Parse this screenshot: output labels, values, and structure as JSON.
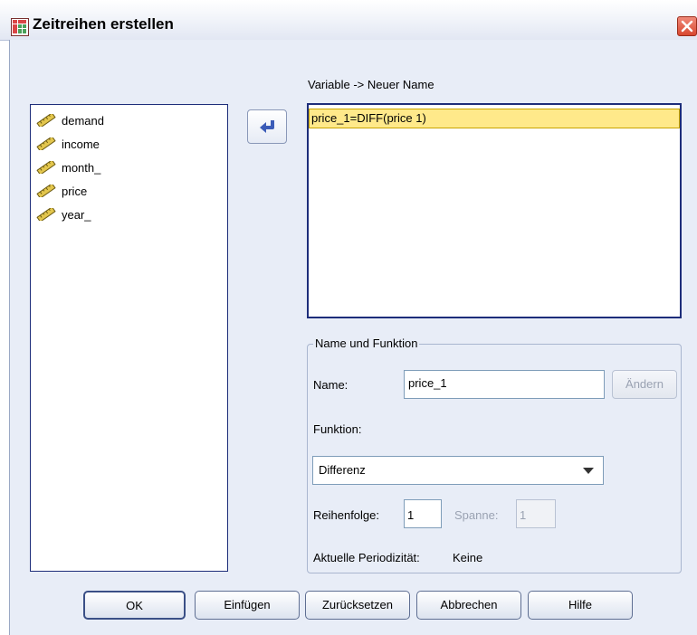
{
  "window": {
    "title": "Zeitreihen erstellen",
    "close_label": "✕"
  },
  "variables": [
    {
      "name": "demand"
    },
    {
      "name": "income"
    },
    {
      "name": "month_"
    },
    {
      "name": "price"
    },
    {
      "name": "year_"
    }
  ],
  "result": {
    "header": "Variable -> Neuer Name",
    "items": [
      "price_1=DIFF(price 1)"
    ]
  },
  "group": {
    "legend": "Name und Funktion",
    "name_label": "Name:",
    "name_value": "price_1",
    "change_button": "Ändern",
    "function_label": "Funktion:",
    "function_value": "Differenz",
    "order_label": "Reihenfolge:",
    "order_value": "1",
    "span_label": "Spanne:",
    "span_value": "1",
    "periodicity_label": "Aktuelle Periodizität:",
    "periodicity_value": "Keine"
  },
  "buttons": {
    "ok": "OK",
    "paste": "Einfügen",
    "reset": "Zurücksetzen",
    "cancel": "Abbrechen",
    "help": "Hilfe"
  },
  "colors": {
    "dialog_bg": "#e8edf7",
    "list_border": "#1d2d7a",
    "selection": "#ffe98a",
    "arrow": "#3b5cb8"
  }
}
